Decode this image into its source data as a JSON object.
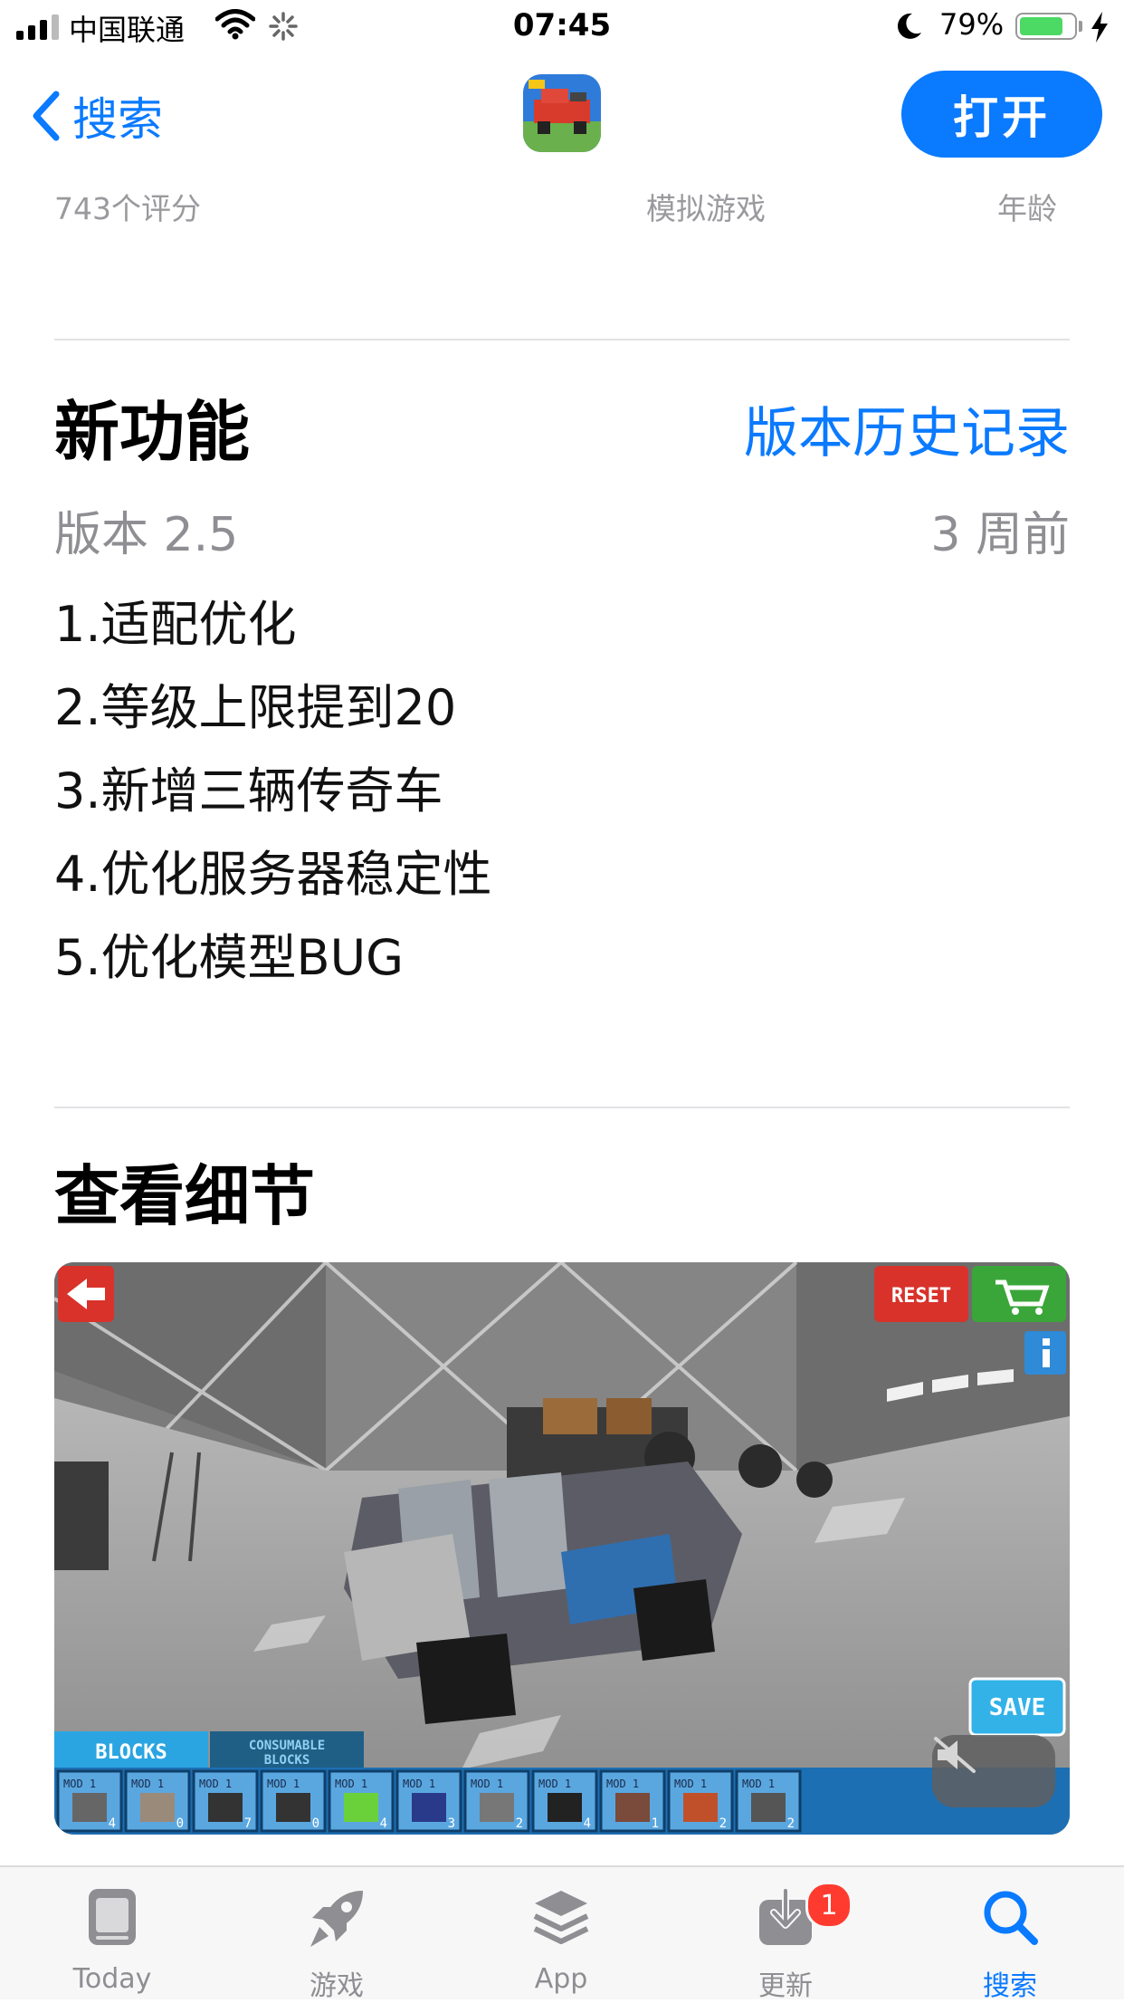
{
  "status_bar": {
    "carrier": "中国联通",
    "time": "07:45",
    "battery_percent": "79%",
    "battery_level": 0.79,
    "battery_color": "#4cd964"
  },
  "nav": {
    "back_label": "搜索",
    "open_label": "打开",
    "accent": "#0a7aff"
  },
  "info_row": {
    "ratings": "743个评分",
    "category": "模拟游戏",
    "age": "年龄"
  },
  "whats_new": {
    "title": "新功能",
    "history_link": "版本历史记录",
    "version": "版本 2.5",
    "time_ago": "3 周前",
    "notes": [
      "1.适配优化",
      "2.等级上限提到20",
      "3.新增三辆传奇车",
      "4.优化服务器稳定性",
      "5.优化模型BUG"
    ]
  },
  "details": {
    "title": "查看细节",
    "game_ui": {
      "reset": "RESET",
      "save": "SAVE",
      "tab_blocks": "BLOCKS",
      "tab_consumable_1": "CONSUMABLE",
      "tab_consumable_2": "BLOCKS",
      "mod_label": "MOD 1",
      "slot_counts": [
        "4",
        "0",
        "7",
        "0",
        "4",
        "3",
        "2",
        "4",
        "1",
        "2",
        "2"
      ]
    }
  },
  "tab_bar": {
    "tabs": [
      {
        "label": "Today",
        "icon": "today-icon",
        "active": false
      },
      {
        "label": "游戏",
        "icon": "rocket-icon",
        "active": false
      },
      {
        "label": "App",
        "icon": "layers-icon",
        "active": false
      },
      {
        "label": "更新",
        "icon": "download-icon",
        "active": false
      },
      {
        "label": "搜索",
        "icon": "search-icon",
        "active": true
      }
    ],
    "updates_badge": "1"
  }
}
